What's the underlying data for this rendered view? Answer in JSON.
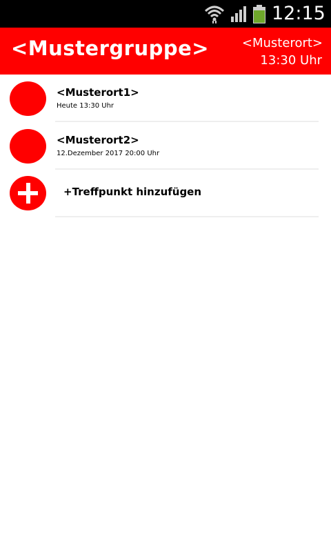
{
  "status_bar": {
    "time": "12:15",
    "icons": [
      "wifi-icon",
      "signal-icon",
      "battery-icon"
    ]
  },
  "header": {
    "group_name": "<Mustergruppe>",
    "place": "<Musterort>",
    "time": "13:30 Uhr",
    "color": "#ff0000"
  },
  "meeting_points": [
    {
      "name": "<Musterort1>",
      "time": "Heute 13:30 Uhr"
    },
    {
      "name": "<Musterort2>",
      "time": "12.Dezember 2017 20:00 Uhr"
    }
  ],
  "add_meeting_point": {
    "label": "+Treffpunkt hinzufügen",
    "icon": "plus-icon"
  },
  "colors": {
    "accent": "#ff0000",
    "status_bar": "#000000",
    "divider": "#eeeeee"
  }
}
